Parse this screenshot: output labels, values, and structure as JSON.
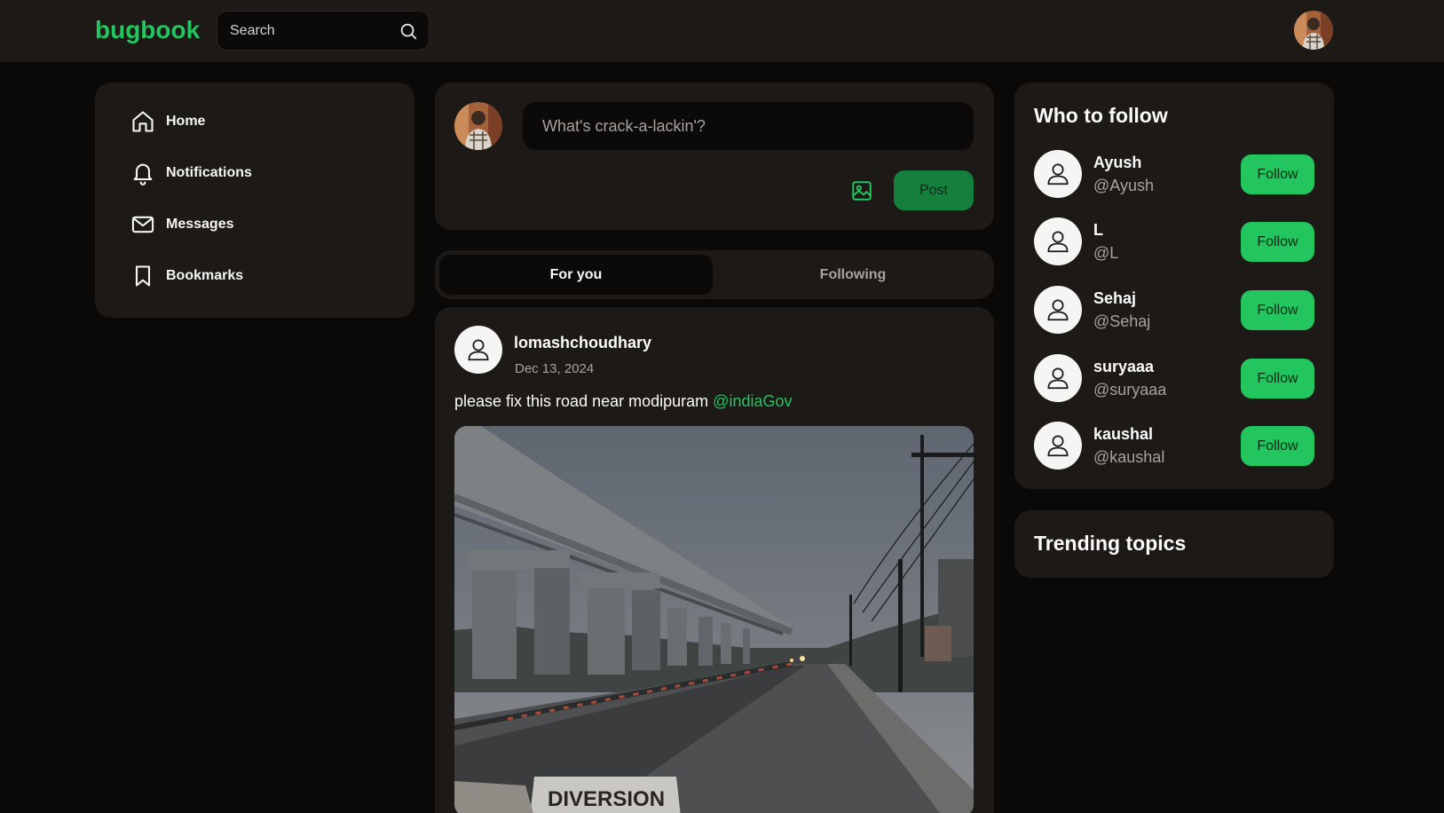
{
  "header": {
    "logo": "bugbook",
    "search_placeholder": "Search"
  },
  "sidebar": {
    "items": [
      {
        "label": "Home",
        "icon": "home-icon"
      },
      {
        "label": "Notifications",
        "icon": "bell-icon"
      },
      {
        "label": "Messages",
        "icon": "mail-icon"
      },
      {
        "label": "Bookmarks",
        "icon": "bookmark-icon"
      }
    ]
  },
  "composer": {
    "placeholder": "What's crack-a-lackin'?",
    "post_label": "Post"
  },
  "tabs": {
    "active": "For you",
    "inactive": "Following"
  },
  "post": {
    "author": "lomashchoudhary",
    "date": "Dec 13, 2024",
    "text": "please fix this road near modipuram",
    "mention": "@indiaGov",
    "image_sign": "DIVERSION"
  },
  "who_to_follow": {
    "title": "Who to follow",
    "button_label": "Follow",
    "users": [
      {
        "name": "Ayush",
        "handle": "@Ayush"
      },
      {
        "name": "L",
        "handle": "@L"
      },
      {
        "name": "Sehaj",
        "handle": "@Sehaj"
      },
      {
        "name": "suryaaa",
        "handle": "@suryaaa"
      },
      {
        "name": "kaushal",
        "handle": "@kaushal"
      }
    ]
  },
  "trending": {
    "title": "Trending topics"
  },
  "colors": {
    "brand": "#22c55e",
    "card": "#1c1917",
    "background": "#0a0908"
  }
}
